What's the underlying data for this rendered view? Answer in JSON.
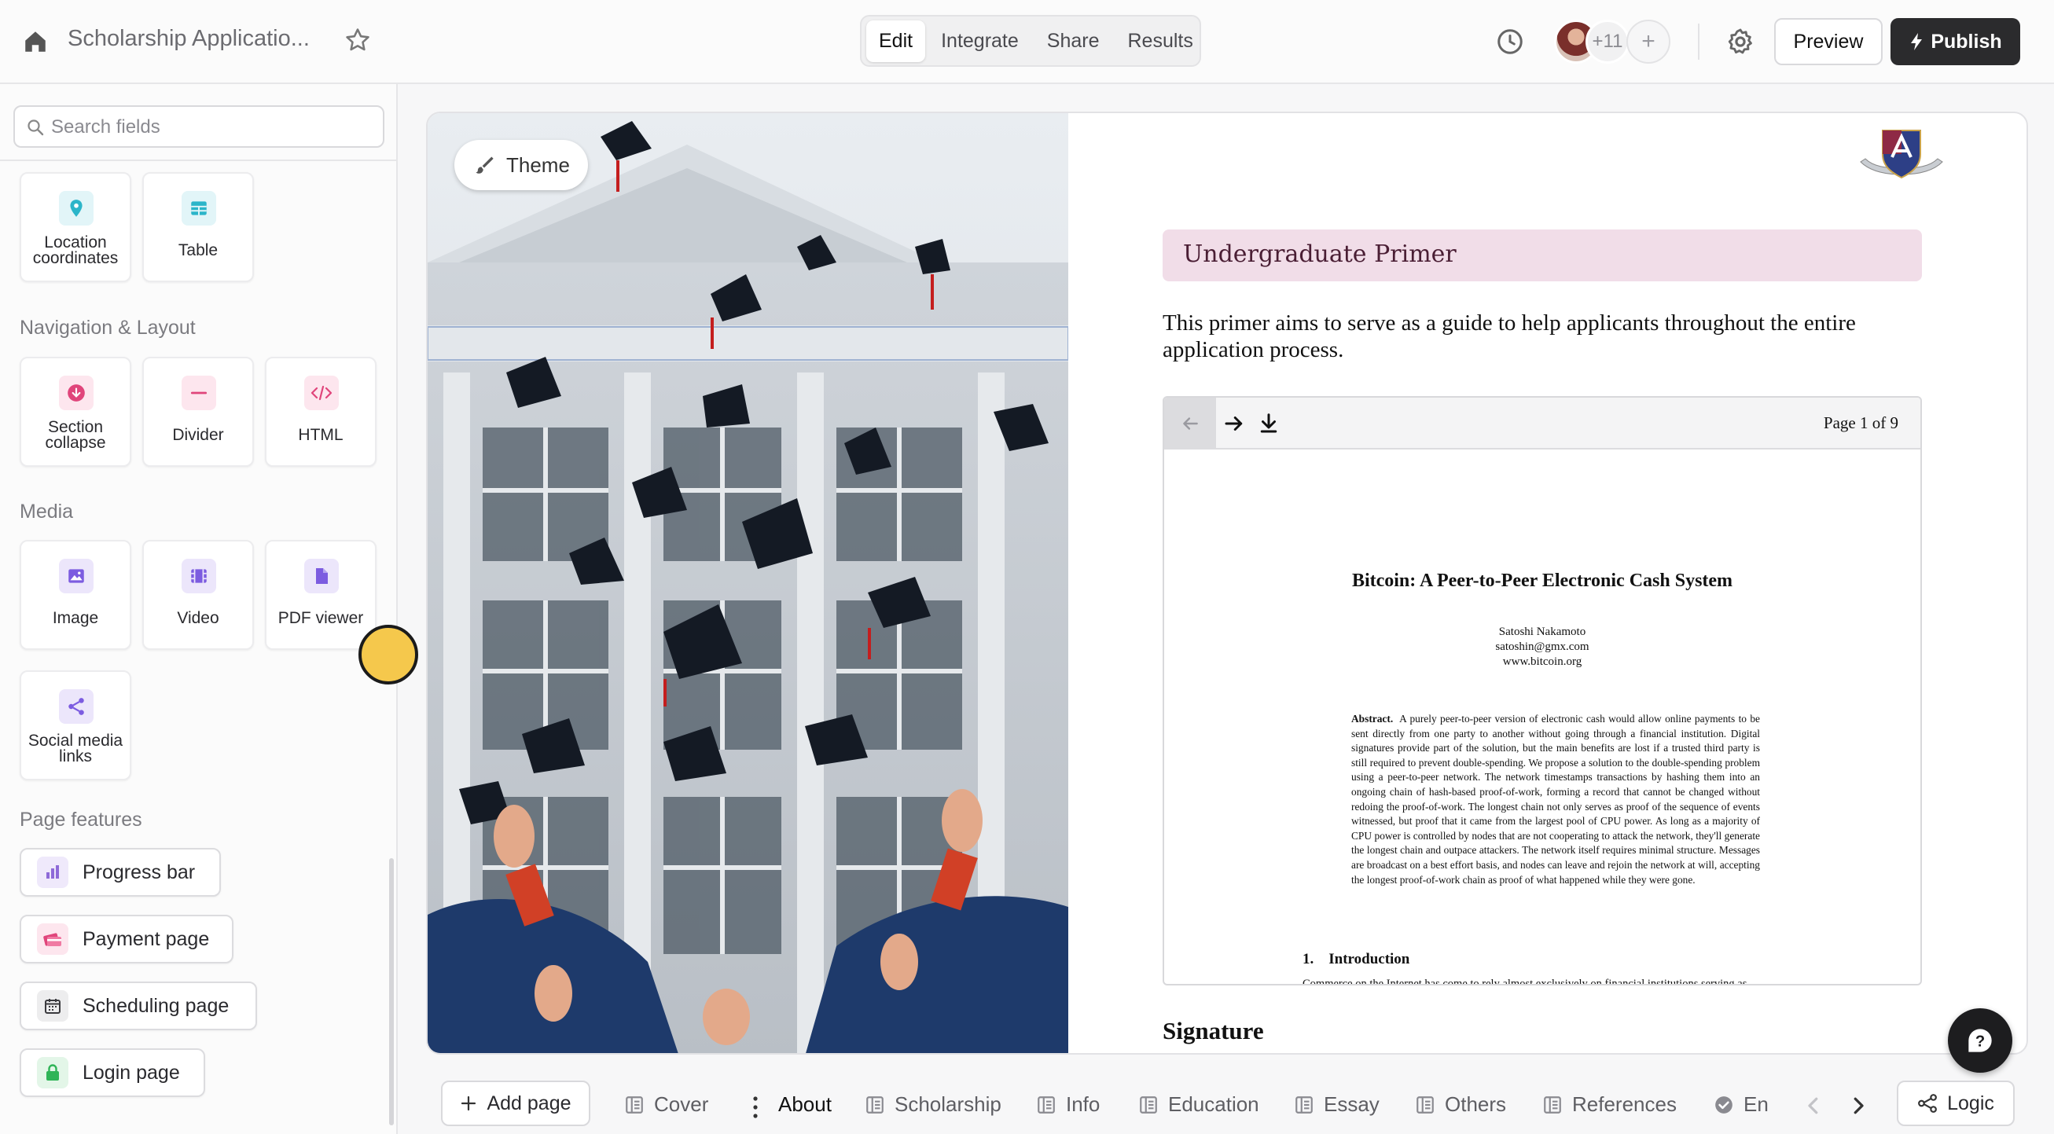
{
  "topbar": {
    "title": "Scholarship Applicatio...",
    "mode_tabs": [
      {
        "label": "Edit",
        "active": true
      },
      {
        "label": "Integrate",
        "active": false
      },
      {
        "label": "Share",
        "active": false
      },
      {
        "label": "Results",
        "active": false
      }
    ],
    "collaborator_count": "+11",
    "add_collaborator": "+",
    "preview_label": "Preview",
    "publish_label": "Publish"
  },
  "sidebar": {
    "search_placeholder": "Search fields",
    "top_tiles": [
      {
        "label": "Location coordinates",
        "icon": "location-pin-icon",
        "color": "#2bb5c9"
      },
      {
        "label": "Table",
        "icon": "table-icon",
        "color": "#2bb5c9"
      }
    ],
    "sections": {
      "navigation": {
        "title": "Navigation & Layout",
        "tiles": [
          {
            "label": "Section collapse",
            "icon": "section-collapse-icon",
            "color": "#e0457b"
          },
          {
            "label": "Divider",
            "icon": "divider-icon",
            "color": "#e0457b"
          },
          {
            "label": "HTML",
            "icon": "code-icon",
            "color": "#e0457b"
          }
        ]
      },
      "media": {
        "title": "Media",
        "tiles": [
          {
            "label": "Image",
            "icon": "image-icon",
            "color": "#7c5ce0"
          },
          {
            "label": "Video",
            "icon": "video-icon",
            "color": "#7c5ce0"
          },
          {
            "label": "PDF viewer",
            "icon": "document-icon",
            "color": "#7c5ce0"
          },
          {
            "label": "Social media links",
            "icon": "share-icon",
            "color": "#7c5ce0"
          }
        ]
      },
      "page_features": {
        "title": "Page features",
        "items": [
          {
            "label": "Progress bar",
            "icon": "bar-chart-icon",
            "color": "#8e6ad8"
          },
          {
            "label": "Payment page",
            "icon": "payment-icon",
            "color": "#e0457b"
          },
          {
            "label": "Scheduling page",
            "icon": "calendar-icon",
            "color": "#3a3a3e"
          },
          {
            "label": "Login page",
            "icon": "lock-icon",
            "color": "#2fb457"
          }
        ]
      }
    }
  },
  "canvas": {
    "theme_label": "Theme",
    "heading": "Undergraduate Primer",
    "intro": "This primer aims to serve as a guide to help applicants throughout the entire application process.",
    "pdf": {
      "page_indicator": "Page 1 of 9",
      "title": "Bitcoin: A Peer-to-Peer Electronic Cash System",
      "author": "Satoshi Nakamoto",
      "email": "satoshin@gmx.com",
      "website": "www.bitcoin.org",
      "abstract_label": "Abstract.",
      "abstract_text": "A purely peer-to-peer version of electronic cash would allow online payments to be sent directly from one party to another without going through a financial institution. Digital signatures provide part of the solution, but the main benefits are lost if a trusted third party is still required to prevent double-spending. We propose a solution to the double-spending problem using a peer-to-peer network. The network timestamps transactions by hashing them into an ongoing chain of hash-based proof-of-work, forming a record that cannot be changed without redoing the proof-of-work. The longest chain not only serves as proof of the sequence of events witnessed, but proof that it came from the largest pool of CPU power. As long as a majority of CPU power is controlled by nodes that are not cooperating to attack the network, they'll generate the longest chain and outpace attackers. The network itself requires minimal structure. Messages are broadcast on a best effort basis, and nodes can leave and rejoin the network at will, accepting the longest proof-of-work chain as proof of what happened while they were gone.",
      "section_number": "1.",
      "section_title": "Introduction",
      "section_first_line": "Commerce on the Internet has come to rely almost exclusively on financial institutions serving as"
    },
    "signature_heading": "Signature"
  },
  "pagebar": {
    "add_page_label": "Add page",
    "pages": [
      {
        "label": "Cover",
        "active": false,
        "icon": "page-icon"
      },
      {
        "label": "About",
        "active": true,
        "icon": ""
      },
      {
        "label": "Scholarship",
        "active": false,
        "icon": "page-icon"
      },
      {
        "label": "Info",
        "active": false,
        "icon": "page-icon"
      },
      {
        "label": "Education",
        "active": false,
        "icon": "page-icon"
      },
      {
        "label": "Essay",
        "active": false,
        "icon": "page-icon"
      },
      {
        "label": "Others",
        "active": false,
        "icon": "page-icon"
      },
      {
        "label": "References",
        "active": false,
        "icon": "page-icon"
      },
      {
        "label": "En",
        "active": false,
        "icon": "check-circle-icon"
      }
    ],
    "logic_label": "Logic"
  }
}
